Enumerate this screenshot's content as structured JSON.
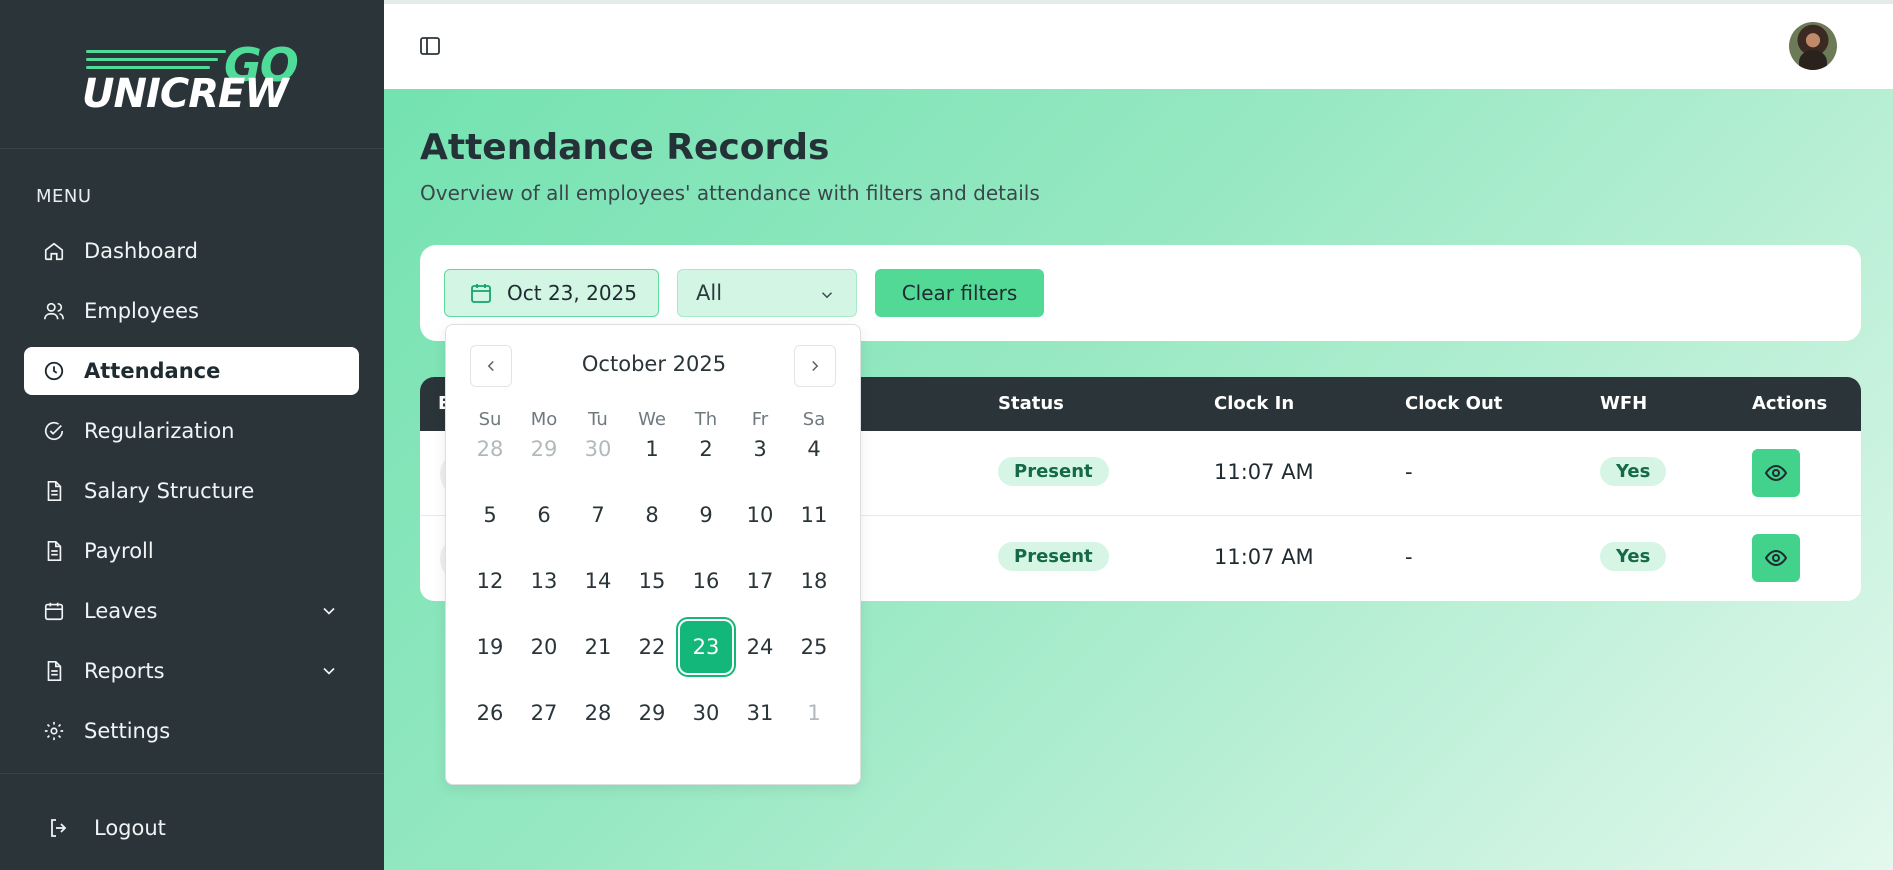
{
  "brand": {
    "logo_top": "GO",
    "logo_bottom": "UNICREW",
    "accent": "#4fdb98",
    "sidebar_bg": "#2b3539"
  },
  "sidebar": {
    "menu_label": "MENU",
    "items": [
      {
        "label": "Dashboard",
        "icon": "home-icon"
      },
      {
        "label": "Employees",
        "icon": "users-icon"
      },
      {
        "label": "Attendance",
        "icon": "clock-icon",
        "active": true
      },
      {
        "label": "Regularization",
        "icon": "check-circle-icon"
      },
      {
        "label": "Salary Structure",
        "icon": "document-icon"
      },
      {
        "label": "Payroll",
        "icon": "document-icon"
      },
      {
        "label": "Leaves",
        "icon": "calendar-icon",
        "expandable": true
      },
      {
        "label": "Reports",
        "icon": "document-icon",
        "expandable": true
      },
      {
        "label": "Settings",
        "icon": "gear-icon"
      }
    ],
    "logout_label": "Logout"
  },
  "page": {
    "title": "Attendance Records",
    "subtitle": "Overview of all employees' attendance with filters and details"
  },
  "filters": {
    "date_value": "Oct 23, 2025",
    "status_value": "All",
    "clear_label": "Clear filters"
  },
  "table": {
    "headers": [
      "E",
      "Status",
      "Clock In",
      "Clock Out",
      "WFH",
      "Actions"
    ],
    "rows": [
      {
        "status": "Present",
        "clock_in": "11:07 AM",
        "clock_out": "-",
        "wfh": "Yes"
      },
      {
        "status": "Present",
        "clock_in": "11:07 AM",
        "clock_out": "-",
        "wfh": "Yes"
      }
    ]
  },
  "calendar": {
    "month_label": "October 2025",
    "weekdays": [
      "Su",
      "Mo",
      "Tu",
      "We",
      "Th",
      "Fr",
      "Sa"
    ],
    "weeks": [
      [
        "28",
        "29",
        "30",
        "1",
        "2",
        "3",
        "4"
      ],
      [
        "5",
        "6",
        "7",
        "8",
        "9",
        "10",
        "11"
      ],
      [
        "12",
        "13",
        "14",
        "15",
        "16",
        "17",
        "18"
      ],
      [
        "19",
        "20",
        "21",
        "22",
        "23",
        "24",
        "25"
      ],
      [
        "26",
        "27",
        "28",
        "29",
        "30",
        "31",
        "1"
      ]
    ],
    "selected_day": "23",
    "selected_color": "#14b77a"
  }
}
